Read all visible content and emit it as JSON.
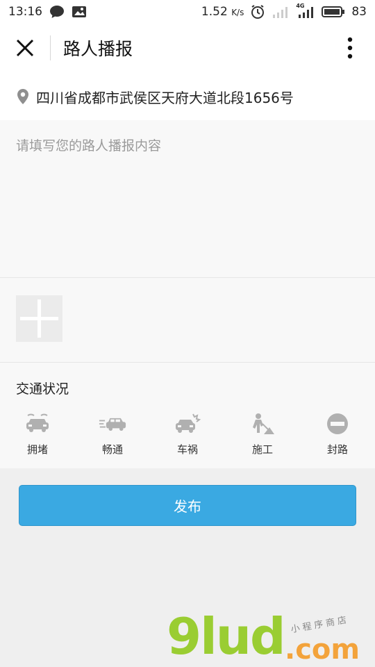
{
  "status_bar": {
    "time": "13:16",
    "speed": "1.52",
    "speed_unit": "K/s",
    "network": "4G",
    "battery": "83"
  },
  "header": {
    "title": "路人播报"
  },
  "location": {
    "address": "四川省成都市武侯区天府大道北段1656号"
  },
  "content": {
    "placeholder": "请填写您的路人播报内容"
  },
  "traffic": {
    "title": "交通状况",
    "options": [
      {
        "label": "拥堵",
        "icon": "congested-car-icon"
      },
      {
        "label": "畅通",
        "icon": "moving-car-icon"
      },
      {
        "label": "车祸",
        "icon": "car-crash-icon"
      },
      {
        "label": "施工",
        "icon": "construction-worker-icon"
      },
      {
        "label": "封路",
        "icon": "road-closed-icon"
      }
    ]
  },
  "actions": {
    "publish_label": "发布"
  },
  "watermark": {
    "brand": "9lud",
    "domain": ".com",
    "tagline": "小程序商店"
  },
  "colors": {
    "accent": "#3aa9e2",
    "icon_gray": "#b0b0b0",
    "background": "#efefef"
  }
}
